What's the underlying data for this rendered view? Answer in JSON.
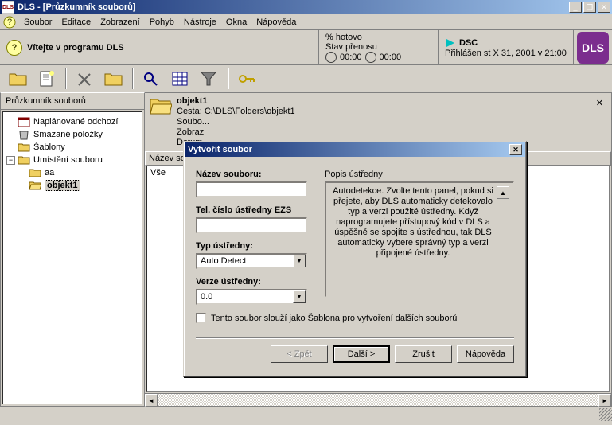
{
  "title": "DLS - [Průzkumník souborů]",
  "menus": [
    "Soubor",
    "Editace",
    "Zobrazení",
    "Pohyb",
    "Nástroje",
    "Okna",
    "Nápověda"
  ],
  "welcome": "Vítejte v programu DLS",
  "status_transfer": {
    "label_percent": "% hotovo",
    "label_state": "Stav přenosu",
    "time1": "00:00",
    "time2": "00:00"
  },
  "status_conn": {
    "label": "DSC",
    "info": "Přihlášen st X 31, 2001 v 21:00"
  },
  "logo_text": "DLS",
  "explorer_title": "Průzkumník souborů",
  "tree": {
    "scheduled": "Naplánované odchozí",
    "deleted": "Smazané položky",
    "templates": "Šablony",
    "file_loc": "Umístění souboru",
    "aa": "aa",
    "objekt1": "objekt1"
  },
  "object_panel": {
    "title": "objekt1",
    "path_label": "Cesta: C:\\DLS\\Folders\\objekt1",
    "count_label": "Soubo...",
    "shown_label": "Zobraz",
    "date_label": "Datum"
  },
  "list": {
    "col_name": "Název soubo",
    "all": "Vše"
  },
  "dialog": {
    "title": "Vytvořit soubor",
    "name_label": "Název souboru:",
    "name_value": "",
    "tel_label": "Tel. číslo ústředny EZS",
    "tel_value": "",
    "type_label": "Typ ústředny:",
    "type_value": "Auto Detect",
    "version_label": "Verze ústředny:",
    "version_value": "0.0",
    "desc_title": "Popis ústředny",
    "desc_text": "Autodetekce. Zvolte tento panel, pokud si přejete, aby DLS automaticky detekovalo typ a verzi použité ústředny.  Když naprogramujete přístupový kód v DLS a úspěšně se spojíte s ústřednou, tak DLS automaticky vybere správný typ a verzi připojené ústředny.",
    "checkbox_label": "Tento soubor slouží jako Šablona pro vytvoření dalších souborů",
    "btn_back": "< Zpět",
    "btn_next": "Další >",
    "btn_cancel": "Zrušit",
    "btn_help": "Nápověda"
  }
}
